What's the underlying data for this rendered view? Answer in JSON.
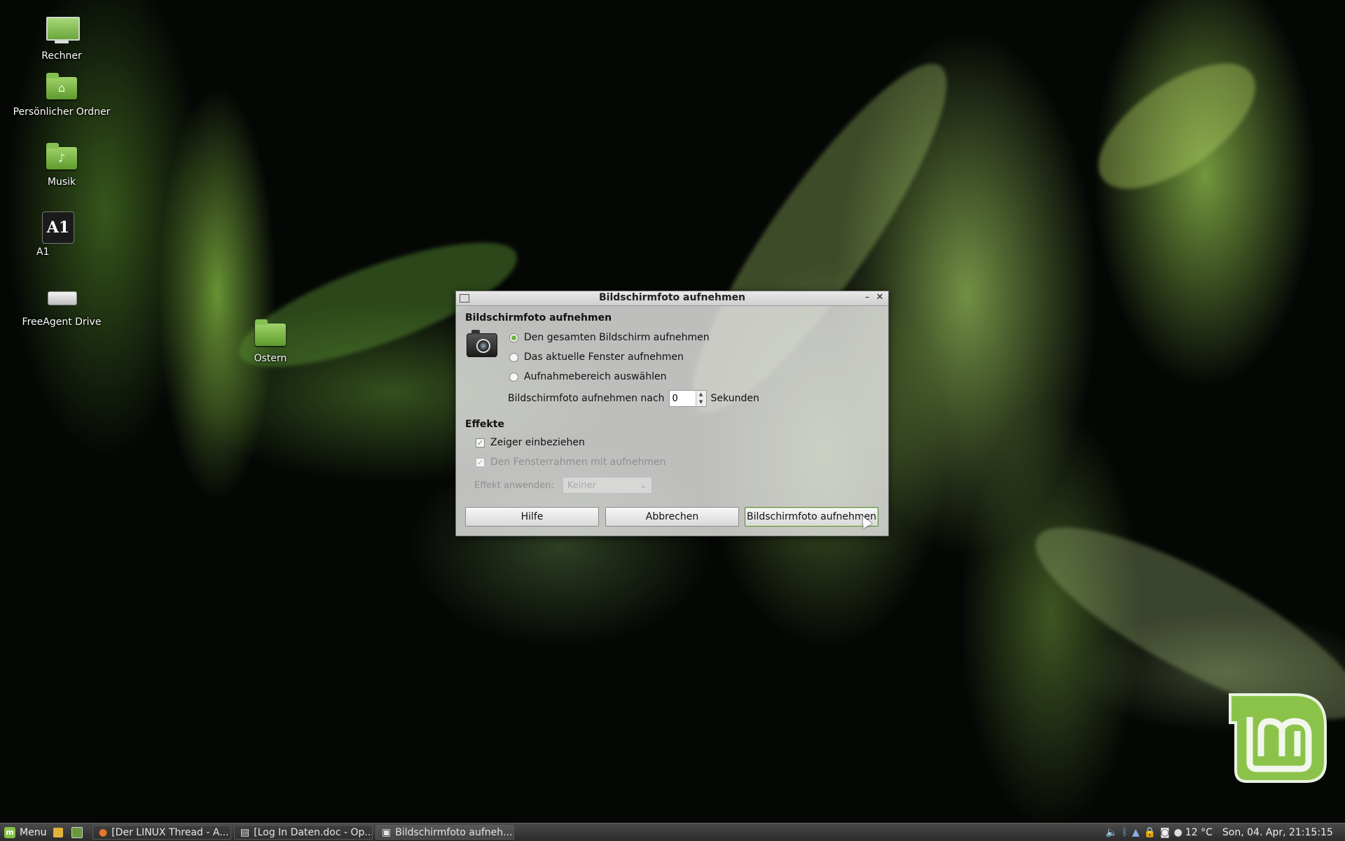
{
  "desktop": {
    "icons": [
      {
        "label": "Rechner",
        "icon": "computer-icon"
      },
      {
        "label": "Persönlicher Ordner",
        "icon": "home-folder-icon"
      },
      {
        "label": "Musik",
        "icon": "music-folder-icon"
      },
      {
        "label": "A1",
        "icon": "a1-app-icon"
      },
      {
        "label": "FreeAgent Drive",
        "icon": "drive-icon"
      },
      {
        "label": "Ostern",
        "icon": "folder-icon"
      }
    ]
  },
  "dialog": {
    "window_title": "Bildschirmfoto aufnehmen",
    "heading": "Bildschirmfoto aufnehmen",
    "capture_options": [
      {
        "label": "Den gesamten Bildschirm aufnehmen",
        "selected": true
      },
      {
        "label": "Das aktuelle Fenster aufnehmen",
        "selected": false
      },
      {
        "label": "Aufnahmebereich auswählen",
        "selected": false
      }
    ],
    "delay_label": "Bildschirmfoto aufnehmen nach",
    "delay_value": "0",
    "delay_unit": "Sekunden",
    "effects_heading": "Effekte",
    "include_pointer_label": "Zeiger einbeziehen",
    "include_pointer_checked": true,
    "include_border_label": "Den Fensterrahmen mit aufnehmen",
    "include_border_checked": true,
    "apply_effect_label": "Effekt anwenden:",
    "apply_effect_value": "Keiner",
    "buttons": {
      "help": "Hilfe",
      "cancel": "Abbrechen",
      "take": "Bildschirmfoto aufnehmen"
    }
  },
  "taskbar": {
    "menu_label": "Menu",
    "tasks": [
      {
        "label": "[Der LINUX Thread - A...",
        "icon": "firefox-icon"
      },
      {
        "label": "[Log In Daten.doc - Op...",
        "icon": "document-icon"
      },
      {
        "label": "Bildschirmfoto aufneh...",
        "icon": "screenshot-icon"
      }
    ],
    "weather": "12 °C",
    "clock": "Son, 04. Apr, 21:15:15"
  },
  "colors": {
    "accent": "#6db33f",
    "taskbar": "#333333"
  }
}
